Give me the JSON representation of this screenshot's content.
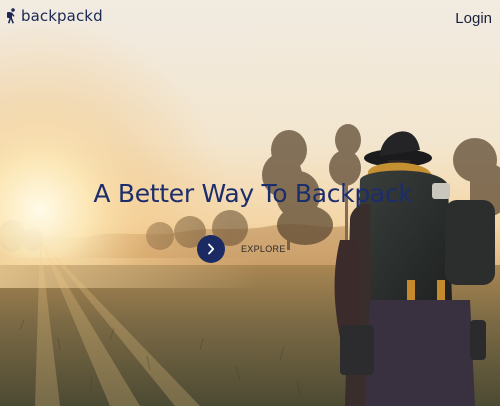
{
  "brand": {
    "name": "backpackd",
    "icon": "hiker-icon",
    "color": "#1c2752"
  },
  "nav": {
    "login_label": "Login"
  },
  "hero": {
    "title": "A Better Way To Backpack",
    "explore_label": "EXPLORE",
    "explore_icon": "chevron-right-icon",
    "accent_color": "#1b2a62"
  }
}
